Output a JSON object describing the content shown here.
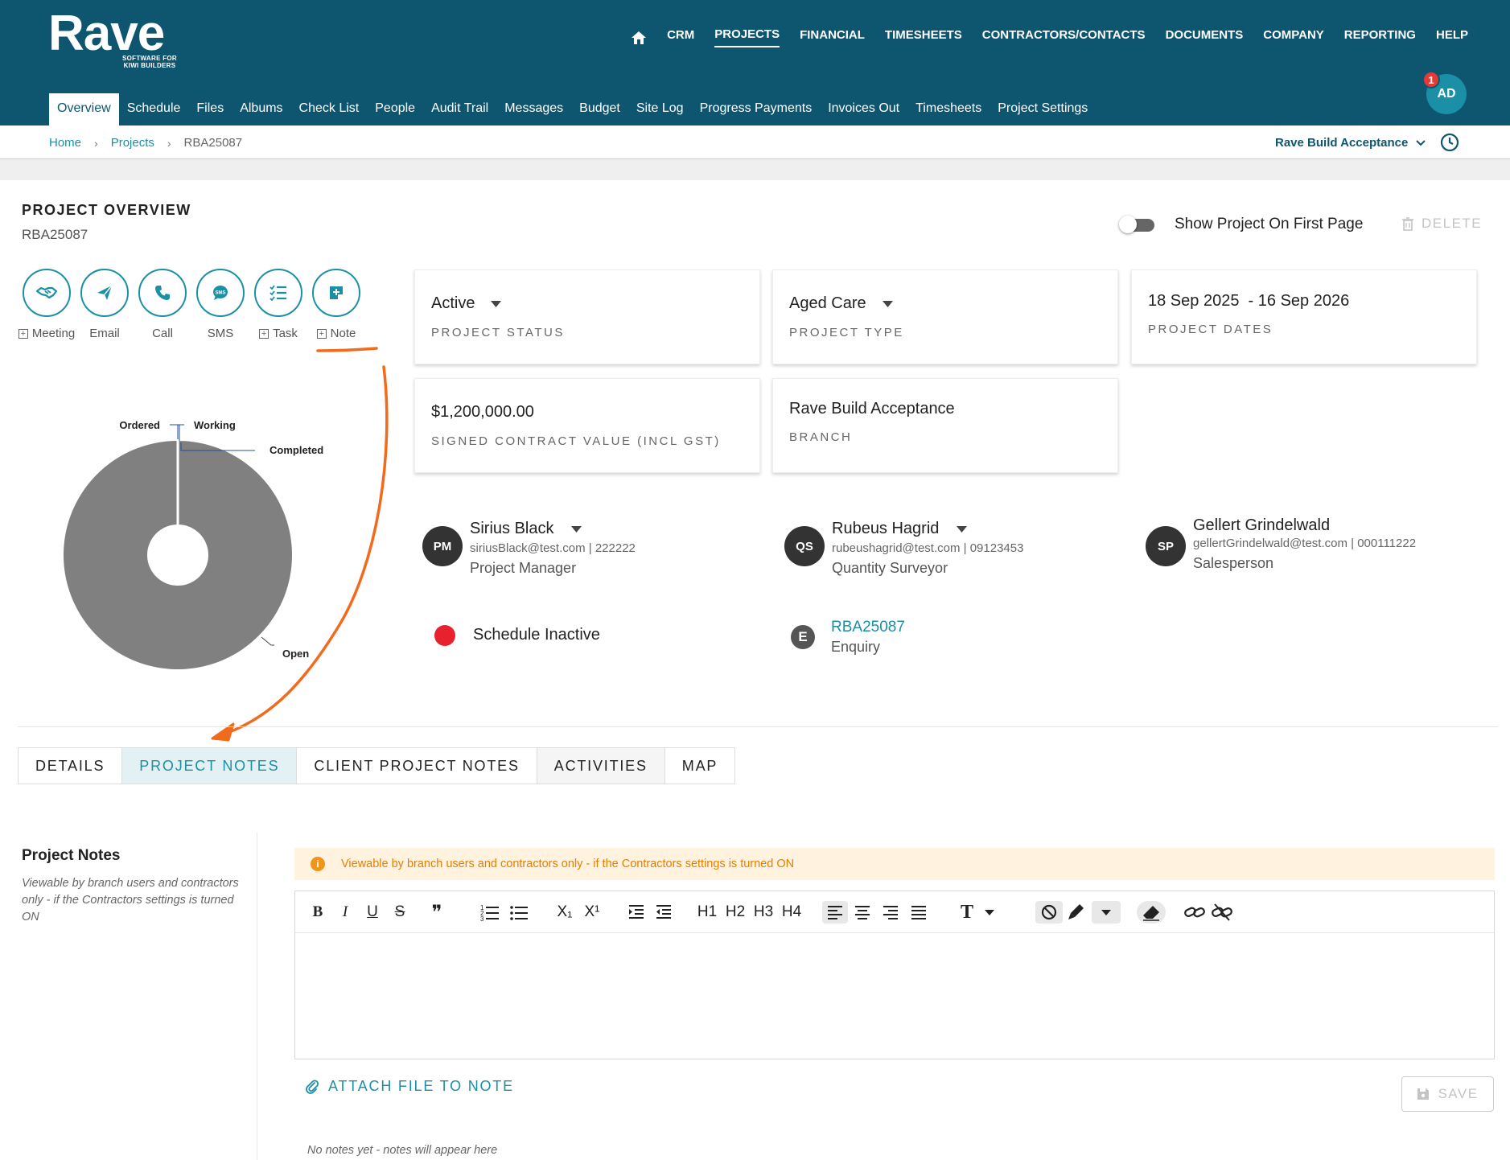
{
  "header": {
    "logo_word": "Rave",
    "logo_tag_line1": "SOFTWARE FOR",
    "logo_tag_line2": "KIWI BUILDERS",
    "nav": [
      "CRM",
      "PROJECTS",
      "FINANCIAL",
      "TIMESHEETS",
      "CONTRACTORS/CONTACTS",
      "DOCUMENTS",
      "COMPANY",
      "REPORTING",
      "HELP"
    ],
    "nav_active": "PROJECTS",
    "subnav": [
      "Overview",
      "Schedule",
      "Files",
      "Albums",
      "Check List",
      "People",
      "Audit Trail",
      "Messages",
      "Budget",
      "Site Log",
      "Progress Payments",
      "Invoices Out",
      "Timesheets",
      "Project Settings"
    ],
    "subnav_active": "Overview",
    "avatar_initials": "AD",
    "notification_count": "1"
  },
  "breadcrumb": {
    "home": "Home",
    "projects": "Projects",
    "current": "RBA25087",
    "branch": "Rave Build Acceptance"
  },
  "overview": {
    "title": "PROJECT OVERVIEW",
    "code": "RBA25087",
    "toggle_label": "Show Project On First Page",
    "delete_label": "DELETE",
    "actions": [
      {
        "label": "Meeting",
        "icon": "handshake-icon",
        "plus": true
      },
      {
        "label": "Email",
        "icon": "send-icon",
        "plus": false
      },
      {
        "label": "Call",
        "icon": "phone-icon",
        "plus": false
      },
      {
        "label": "SMS",
        "icon": "sms-icon",
        "plus": false
      },
      {
        "label": "Task",
        "icon": "checklist-icon",
        "plus": true
      },
      {
        "label": "Note",
        "icon": "note-add-icon",
        "plus": true
      }
    ]
  },
  "cards": {
    "status_value": "Active",
    "status_caption": "PROJECT STATUS",
    "type_value": "Aged Care",
    "type_caption": "PROJECT TYPE",
    "dates_value": "18 Sep 2025  - 16 Sep 2026",
    "dates_caption": "PROJECT DATES",
    "contract_value": "$1,200,000.00",
    "contract_caption": "SIGNED CONTRACT VALUE (INCL GST)",
    "branch_value": "Rave Build Acceptance",
    "branch_caption": "BRANCH"
  },
  "people": [
    {
      "initials": "PM",
      "name": "Sirius Black",
      "contact": "siriusBlack@test.com | 222222",
      "role": "Project Manager"
    },
    {
      "initials": "QS",
      "name": "Rubeus Hagrid",
      "contact": "rubeushagrid@test.com | 09123453",
      "role": "Quantity Surveyor"
    },
    {
      "initials": "SP",
      "name": "Gellert Grindelwald",
      "contact": "gellertGrindelwald@test.com | 000111222",
      "role": "Salesperson"
    }
  ],
  "schedule": {
    "label": "Schedule Inactive",
    "color": "#e8212f"
  },
  "enquiry": {
    "letter": "E",
    "code": "RBA25087",
    "label": "Enquiry"
  },
  "chart_data": {
    "type": "pie",
    "categories": [
      "Ordered",
      "Working",
      "Completed",
      "Open"
    ],
    "values": [
      0,
      0,
      0,
      100
    ],
    "colors": [
      "#1f4e9e",
      "#1f4e9e",
      "#1f4e9e",
      "#808080"
    ],
    "title": ""
  },
  "tabs": [
    "DETAILS",
    "PROJECT NOTES",
    "CLIENT PROJECT NOTES",
    "ACTIVITIES",
    "MAP"
  ],
  "tabs_active": "PROJECT NOTES",
  "notes": {
    "title": "Project Notes",
    "description": "Viewable by branch users and contractors only - if the Contractors settings is turned ON",
    "banner": "Viewable by branch users and contractors only - if the Contractors settings is turned ON",
    "attach_label": "ATTACH FILE TO NOTE",
    "save_label": "SAVE",
    "empty": "No notes yet - notes will appear here"
  },
  "toolbar": {
    "h1": "H1",
    "h2": "H2",
    "h3": "H3",
    "h4": "H4",
    "bold": "B",
    "italic": "I",
    "underline": "U",
    "strike": "S",
    "quote": "❞",
    "subscript": "X₁",
    "superscript": "X¹",
    "text_style": "T"
  },
  "colors": {
    "brand": "#0e5670",
    "accent": "#1a8fa6",
    "warning": "#e67e00"
  }
}
